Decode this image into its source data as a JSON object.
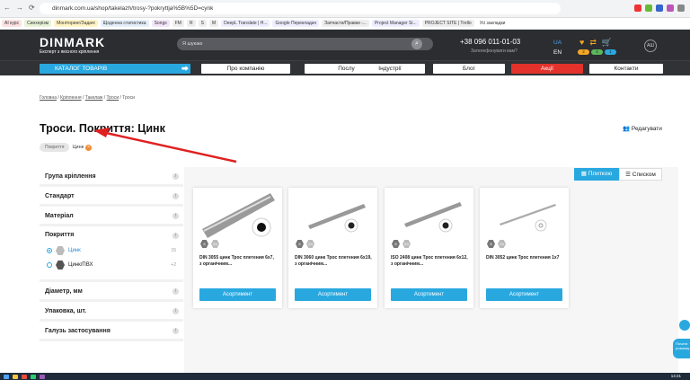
{
  "browser": {
    "url": "dinmark.com.ua/shop/takelazh/trosy-?pokryttja%5B%5D=cynk",
    "bookmarks": [
      "AI курс",
      "Синхерізм",
      "Моніторинг/Задачі",
      "Щоденна статистика",
      "Songs",
      "FM",
      "R",
      "S",
      "M",
      "DeepL Translate | H...",
      "Google Перекладач",
      "Запчасти/Правки -...",
      "Project Manager Si...",
      "PROJECT SITE | Trello",
      "Усі закладки"
    ]
  },
  "header": {
    "logo": "DINMARK",
    "tagline": "Експерт з якісного кріплення",
    "search_placeholder": "Я шукаю",
    "phone": "+38 096 011-01-03",
    "callback": "Зателефонувати вам?",
    "lang_ua": "UA",
    "lang_en": "EN",
    "badges": [
      "2",
      "4",
      "1"
    ],
    "avatar_text": "АШ"
  },
  "nav": {
    "catalog": "КАТАЛОГ ТОВАРІВ",
    "items": [
      "Про компанію",
      "Послуги",
      "Індустрії",
      "Блог",
      "Акції",
      "Контакти"
    ]
  },
  "breadcrumbs": [
    "Головна",
    "Кріплення",
    "Такелаж",
    "Троси",
    "Троси"
  ],
  "page_title": "Троси. Покриття: Цинк",
  "edit_label": "Редагувати",
  "chips": {
    "filter_name": "Покриття",
    "filter_value": "Цинк"
  },
  "filters": {
    "groups": [
      "Група кріплення",
      "Стандарт",
      "Матеріал"
    ],
    "open_group": "Покриття",
    "options": [
      {
        "label": "Цинк",
        "count": "15",
        "selected": true
      },
      {
        "label": "Цинк/ПВХ",
        "count": "+2",
        "selected": false
      }
    ],
    "groups_after": [
      "Діаметр, мм",
      "Упаковка, шт.",
      "Галузь застосування"
    ]
  },
  "view": {
    "tiles": "Плиткою",
    "list": "Списком"
  },
  "products": [
    {
      "title": "DIN 3055 цинк Трос плетения 6x7, з органічним...",
      "button": "Асортимент"
    },
    {
      "title": "DIN 3060 цинк Трос плетения 6x19, з органічним...",
      "button": "Асортимент"
    },
    {
      "title": "ISO 2408 цинк Трос плетения 6x12, з органічним...",
      "button": "Асортимент"
    },
    {
      "title": "DIN 3052 цинк Трос плетения 1x7",
      "button": "Асортимент"
    }
  ],
  "hex_labels": [
    "8",
    "Zn"
  ],
  "chat_widget": "Почати розмову",
  "clock": "14:21",
  "colors": {
    "accent": "#29a8e0",
    "header_bg": "#2b2d31",
    "promo": "#e2322b",
    "annotation": "#e02020"
  }
}
